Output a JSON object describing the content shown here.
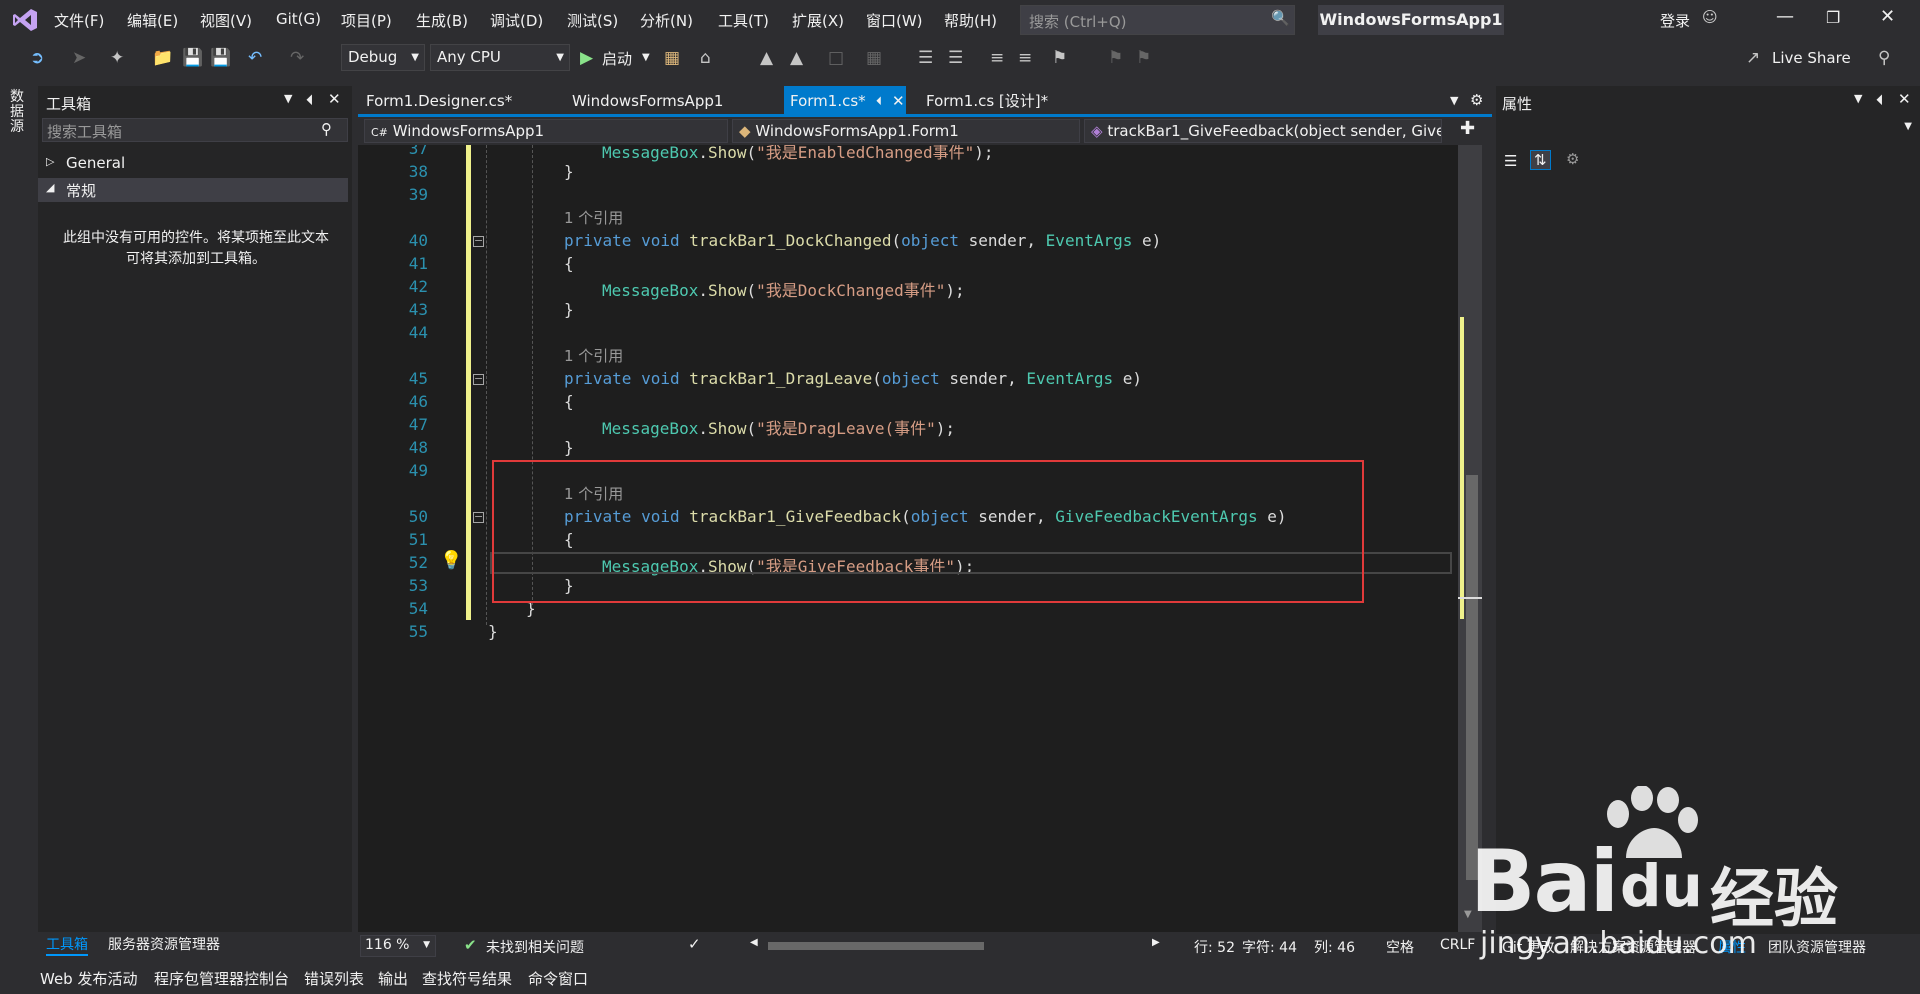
{
  "menu": [
    "文件(F)",
    "编辑(E)",
    "视图(V)",
    "Git(G)",
    "项目(P)",
    "生成(B)",
    "调试(D)",
    "测试(S)",
    "分析(N)",
    "工具(T)",
    "扩展(X)",
    "窗口(W)",
    "帮助(H)"
  ],
  "search": {
    "placeholder": "搜索 (Ctrl+Q)"
  },
  "title": "WindowsFormsApp1",
  "login": "登录",
  "toolbar": {
    "config": "Debug",
    "platform": "Any CPU",
    "start": "启动",
    "live_share": "Live Share"
  },
  "left_strip_label": "数据源",
  "toolbox": {
    "title": "工具箱",
    "search_placeholder": "搜索工具箱",
    "groups": [
      "General",
      "常规"
    ],
    "empty_text": "此组中没有可用的控件。将某项拖至此文本可将其添加到工具箱。",
    "tabs": [
      "工具箱",
      "服务器资源管理器"
    ]
  },
  "editor": {
    "tabs": [
      "Form1.Designer.cs*",
      "WindowsFormsApp1",
      "Form1.cs*",
      "Form1.cs [设计]*"
    ],
    "nav": [
      "WindowsFormsApp1",
      "WindowsFormsApp1.Form1",
      "trackBar1_GiveFeedback(object sender, Give"
    ],
    "ref_text": "1 个引用",
    "line_numbers": [
      "37",
      "38",
      "39",
      "40",
      "41",
      "42",
      "43",
      "44",
      "45",
      "46",
      "47",
      "48",
      "49",
      "50",
      "51",
      "52",
      "53",
      "54",
      "55"
    ],
    "methods": [
      {
        "name": "trackBar1_DockChanged",
        "arg": "EventArgs",
        "msg": "\"我是DockChanged事件\""
      },
      {
        "name": "trackBar1_DragLeave",
        "arg": "EventArgs",
        "msg": "\"我是DragLeave(事件\""
      },
      {
        "name": "trackBar1_GiveFeedback",
        "arg": "GiveFeedbackEventArgs",
        "msg": "\"我是GiveFeedback事件\""
      }
    ],
    "line37_msg": "\"我是EnabledChanged事件\""
  },
  "properties": {
    "title": "属性"
  },
  "status": {
    "zoom": "116 %",
    "issues": "未找到相关问题",
    "line": "行: 52",
    "char": "字符: 44",
    "col": "列: 46",
    "spaces": "空格",
    "eol": "CRLF"
  },
  "right_tabs": [
    "Git 更改",
    "解决方案资源管理器",
    "属性",
    "团队资源管理器"
  ],
  "bottom_tabs": [
    "Web 发布活动",
    "程序包管理器控制台",
    "错误列表",
    "输出",
    "查找符号结果",
    "命令窗口"
  ],
  "watermark": {
    "brand": "Bai",
    "brand2": "du",
    "text": "经验",
    "url": "jingyan.baidu.com"
  }
}
